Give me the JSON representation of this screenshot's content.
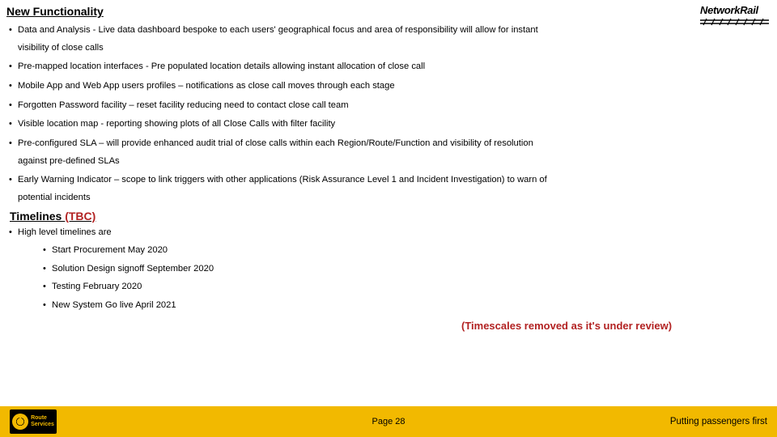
{
  "header": {
    "title": "New Functionality",
    "logo_text": "NetworkRail"
  },
  "bullets": [
    {
      "line": "Data and Analysis - Live data dashboard bespoke to each users' geographical focus and area of responsibility will allow for instant",
      "wrap": "visibility of close calls"
    },
    {
      "line": "Pre-mapped location interfaces -  Pre populated location details allowing instant allocation of close call"
    },
    {
      "line": "Mobile App and Web App users profiles – notifications as close call moves through each stage"
    },
    {
      "line": "Forgotten Password facility – reset facility reducing need to contact close call team"
    },
    {
      "line": "Visible location map - reporting showing plots of all Close Calls with filter facility"
    },
    {
      "line": "Pre-configured SLA – will provide enhanced audit trial of close calls within each Region/Route/Function and visibility of resolution",
      "wrap": "against pre-defined SLAs"
    },
    {
      "line": "Early Warning Indicator – scope to link triggers with other applications (Risk Assurance Level 1 and Incident Investigation) to warn of",
      "wrap": "potential incidents"
    }
  ],
  "timelines": {
    "heading_main": "Timelines ",
    "heading_tbc": "(TBC)",
    "intro": "High level timelines are",
    "items": [
      "Start Procurement May 2020",
      "Solution Design signoff September 2020",
      "Testing February 2020",
      "New System Go live April 2021"
    ],
    "note": "(Timescales removed as it's under review)"
  },
  "footer": {
    "badge_line1": "Route",
    "badge_line2": "Services",
    "page": "Page 28",
    "tagline": "Putting passengers first"
  }
}
